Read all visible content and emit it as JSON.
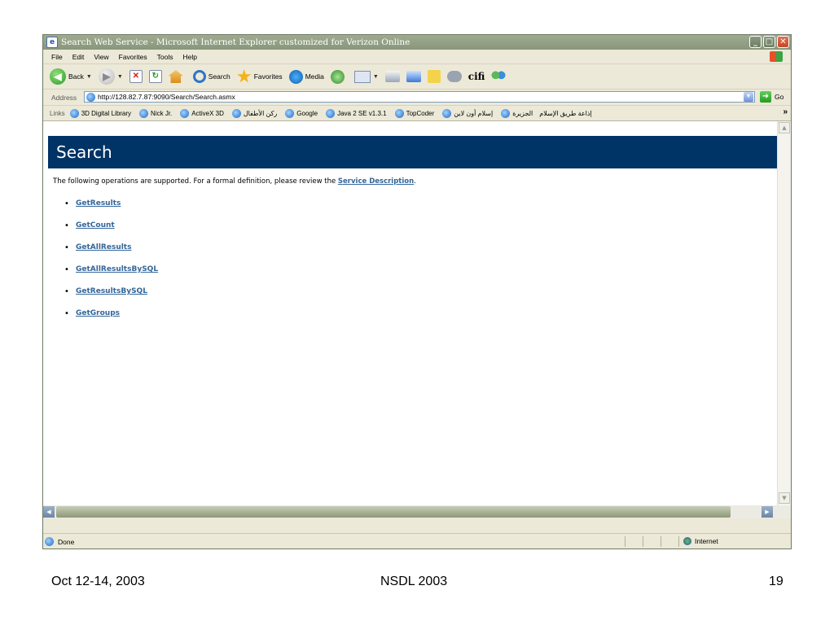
{
  "window": {
    "title": "Search Web Service - Microsoft Internet Explorer customized for Verizon Online",
    "min_glyph": "_",
    "max_glyph": "□",
    "close_glyph": "✕"
  },
  "menubar": [
    "File",
    "Edit",
    "View",
    "Favorites",
    "Tools",
    "Help"
  ],
  "toolbar": {
    "back_label": "Back",
    "search_label": "Search",
    "favorites_label": "Favorites",
    "media_label": "Media",
    "cifi_label": "cifi"
  },
  "address": {
    "label": "Address",
    "url": "http://128.82.7.87:9090/Search/Search.asmx",
    "go_label": "Go"
  },
  "links": {
    "label": "Links",
    "items": [
      "3D Digital Library",
      "Nick Jr.",
      "ActiveX 3D",
      "ركن الأطفال",
      "Google",
      "Java 2 SE v1.3.1",
      "TopCoder",
      "إسلام أون لاين",
      "الجزيرة",
      "إذاعة طريق الإسلام"
    ],
    "more": "»"
  },
  "page": {
    "title": "Search",
    "intro_before": "The following operations are supported. For a formal definition, please review the ",
    "intro_link": "Service Description",
    "intro_after": ".",
    "operations": [
      "GetResults",
      "GetCount",
      "GetAllResults",
      "GetAllResultsBySQL",
      "GetResultsBySQL",
      "GetGroups"
    ],
    "header_color": "#003366",
    "link_color": "#336699"
  },
  "status": {
    "text": "Done",
    "zone": "Internet"
  },
  "footer": {
    "date": "Oct 12-14, 2003",
    "title": "NSDL 2003",
    "page": "19"
  }
}
